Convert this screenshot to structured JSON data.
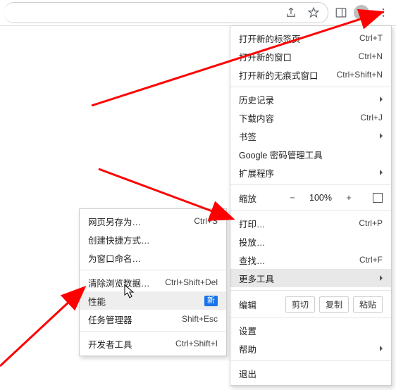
{
  "toolbar": {
    "share_icon": "share-icon",
    "star_icon": "star-icon",
    "side_panel_icon": "side-panel-icon",
    "profile_icon": "profile-icon",
    "kebab_icon": "kebab-icon"
  },
  "main_menu": {
    "new_tab": {
      "label": "打开新的标签页",
      "shortcut": "Ctrl+T"
    },
    "new_window": {
      "label": "打开新的窗口",
      "shortcut": "Ctrl+N"
    },
    "incognito": {
      "label": "打开新的无痕式窗口",
      "shortcut": "Ctrl+Shift+N"
    },
    "history": {
      "label": "历史记录"
    },
    "downloads": {
      "label": "下载内容",
      "shortcut": "Ctrl+J"
    },
    "bookmarks": {
      "label": "书签"
    },
    "password_mgr": {
      "label": "Google 密码管理工具"
    },
    "extensions": {
      "label": "扩展程序"
    },
    "zoom": {
      "label": "缩放",
      "minus": "−",
      "value": "100%",
      "plus": "+"
    },
    "print": {
      "label": "打印…",
      "shortcut": "Ctrl+P"
    },
    "cast": {
      "label": "投放…"
    },
    "find": {
      "label": "查找…",
      "shortcut": "Ctrl+F"
    },
    "more_tools": {
      "label": "更多工具"
    },
    "edit": {
      "label": "编辑",
      "cut": "剪切",
      "copy": "复制",
      "paste": "粘贴"
    },
    "settings": {
      "label": "设置"
    },
    "help": {
      "label": "帮助"
    },
    "exit": {
      "label": "退出"
    }
  },
  "more_tools_menu": {
    "save_as": {
      "label": "网页另存为…",
      "shortcut": "Ctrl+S"
    },
    "create_shortcut": {
      "label": "创建快捷方式…"
    },
    "name_window": {
      "label": "为窗口命名…"
    },
    "clear_data": {
      "label": "清除浏览数据…",
      "shortcut": "Ctrl+Shift+Del"
    },
    "performance": {
      "label": "性能",
      "badge": "新"
    },
    "task_manager": {
      "label": "任务管理器",
      "shortcut": "Shift+Esc"
    },
    "dev_tools": {
      "label": "开发者工具",
      "shortcut": "Ctrl+Shift+I"
    }
  },
  "arrows_color": "#ff0000"
}
